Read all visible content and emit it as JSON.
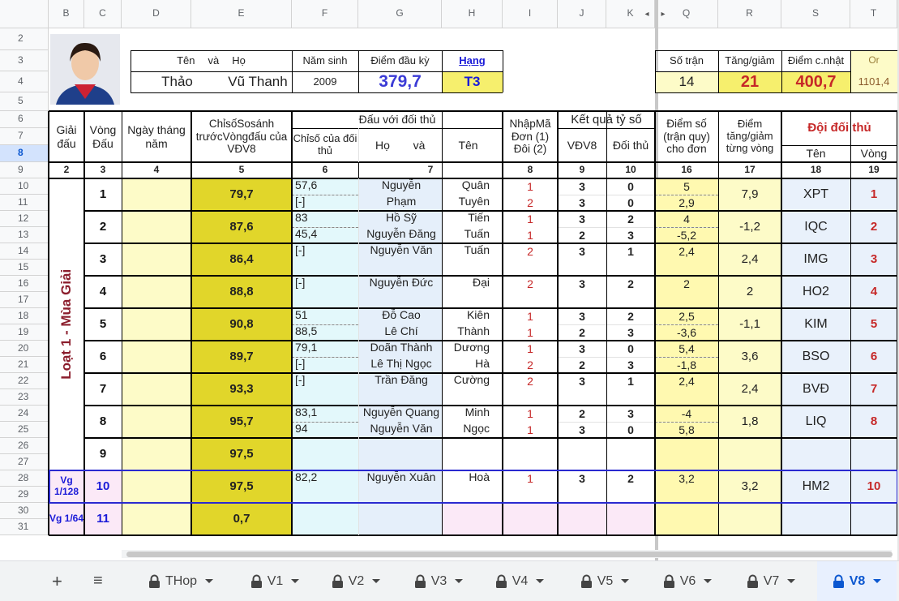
{
  "columns": [
    {
      "label": "B",
      "sel": false
    },
    {
      "label": "C",
      "sel": false
    },
    {
      "label": "D",
      "sel": false
    },
    {
      "label": "E",
      "sel": false
    },
    {
      "label": "F",
      "sel": false
    },
    {
      "label": "G",
      "sel": false
    },
    {
      "label": "H",
      "sel": false
    },
    {
      "label": "I",
      "sel": false
    },
    {
      "label": "J",
      "sel": false
    },
    {
      "label": "K",
      "sel": false
    },
    {
      "label": "Q",
      "sel": false
    },
    {
      "label": "R",
      "sel": false
    },
    {
      "label": "S",
      "sel": false
    },
    {
      "label": "T",
      "sel": false
    }
  ],
  "rows": [
    "2",
    "3",
    "4",
    "5",
    "6",
    "7",
    "8",
    "9",
    "10",
    "11",
    "12",
    "13",
    "14",
    "15",
    "16",
    "17",
    "18",
    "19",
    "20",
    "21",
    "22",
    "23",
    "24",
    "25",
    "26",
    "27",
    "28",
    "29",
    "30",
    "31"
  ],
  "selected_row": "8",
  "profile": {
    "name_header": [
      "Tên",
      "và",
      "Họ"
    ],
    "first_name": "Thảo",
    "last_name": "Vũ Thanh",
    "birth_year_label": "Năm sinh",
    "birth_year": "2009",
    "start_points_label": "Điểm đầu kỳ",
    "start_points": "379,7",
    "rank_label": "Hạng",
    "rank": "T3"
  },
  "summary": {
    "matches_label": "Số trận",
    "matches": "14",
    "change_label": "Tăng/giảm",
    "change": "21",
    "updated_label": "Điểm c.nhật",
    "updated": "400,7",
    "or_label": "Or",
    "or_value": "1101,4"
  },
  "headers": {
    "giai_dau": "Giải đấu",
    "vong_dau": "Vòng Đấu",
    "ngay": "Ngày tháng năm",
    "chiso": "ChỉsốSosánh trướcVòngđấu của VĐV8",
    "dau_voi": "Đấu với đối thủ",
    "chiso_dt": "Chỉsố của đối thủ",
    "ho": "Họ",
    "va": "và",
    "ten": "Tên",
    "nhap_ma": "NhậpMã Đơn (1) Đôi (2)",
    "ket_qua": "Kết quả tỷ số",
    "vdv8": "VĐV8",
    "doi_thu": "Đối thủ",
    "diem_so": "Điểm số (trận quy) cho đơn",
    "diem_tang": "Điểm tăng/giảm từng vòng",
    "doi_doi_thu": "Đội đối thủ",
    "doi_ten": "Tên",
    "doi_vong": "Vòng"
  },
  "col_numbers": [
    "2",
    "3",
    "4",
    "5",
    "6",
    "7",
    "8",
    "9",
    "10",
    "16",
    "17",
    "18",
    "19"
  ],
  "season_label": "Loạt 1 - Mùa Giải",
  "vg1_label": "Vg 1/128",
  "vg2_label": "Vg 1/64",
  "rounds": [
    {
      "vong": "1",
      "chiso": "79,7",
      "tang": "7,9",
      "team": "XPT",
      "team_round": "1",
      "lines": [
        {
          "cs": "57,6",
          "ho": "Nguyễn",
          "ten": "Quân",
          "ma": "1",
          "v": "3",
          "d": "0",
          "pts": "5"
        },
        {
          "cs": "[-]",
          "ho": "Phạm",
          "ten": "Tuyên",
          "ma": "2",
          "v": "3",
          "d": "0",
          "pts": "2,9"
        }
      ]
    },
    {
      "vong": "2",
      "chiso": "87,6",
      "tang": "-1,2",
      "team": "IQC",
      "team_round": "2",
      "lines": [
        {
          "cs": "83",
          "ho": "Hồ Sỹ",
          "ten": "Tiến",
          "ma": "1",
          "v": "3",
          "d": "2",
          "pts": "4"
        },
        {
          "cs": "45,4",
          "ho": "Nguyễn Đăng",
          "ten": "Tuấn",
          "ma": "1",
          "v": "2",
          "d": "3",
          "pts": "-5,2"
        }
      ]
    },
    {
      "vong": "3",
      "chiso": "86,4",
      "tang": "2,4",
      "team": "IMG",
      "team_round": "3",
      "lines": [
        {
          "cs": "[-]",
          "ho": "Nguyễn Văn",
          "ten": "Tuấn",
          "ma": "2",
          "v": "3",
          "d": "1",
          "pts": "2,4"
        }
      ]
    },
    {
      "vong": "4",
      "chiso": "88,8",
      "tang": "2",
      "team": "HO2",
      "team_round": "4",
      "lines": [
        {
          "cs": "[-]",
          "ho": "Nguyễn Đức",
          "ten": "Đại",
          "ma": "2",
          "v": "3",
          "d": "2",
          "pts": "2"
        }
      ]
    },
    {
      "vong": "5",
      "chiso": "90,8",
      "tang": "-1,1",
      "team": "KIM",
      "team_round": "5",
      "lines": [
        {
          "cs": "51",
          "ho": "Đỗ Cao",
          "ten": "Kiên",
          "ma": "1",
          "v": "3",
          "d": "2",
          "pts": "2,5"
        },
        {
          "cs": "88,5",
          "ho": "Lê Chí",
          "ten": "Thành",
          "ma": "1",
          "v": "2",
          "d": "3",
          "pts": "-3,6"
        }
      ]
    },
    {
      "vong": "6",
      "chiso": "89,7",
      "tang": "3,6",
      "team": "BSO",
      "team_round": "6",
      "lines": [
        {
          "cs": "79,1",
          "ho": "Doãn Thành",
          "ten": "Dương",
          "ma": "1",
          "v": "3",
          "d": "0",
          "pts": "5,4"
        },
        {
          "cs": "[-]",
          "ho": "Lê Thị Ngọc",
          "ten": "Hà",
          "ma": "2",
          "v": "2",
          "d": "3",
          "pts": "-1,8"
        }
      ]
    },
    {
      "vong": "7",
      "chiso": "93,3",
      "tang": "2,4",
      "team": "BVĐ",
      "team_round": "7",
      "lines": [
        {
          "cs": "[-]",
          "ho": "Trần Đăng",
          "ten": "Cường",
          "ma": "2",
          "v": "3",
          "d": "1",
          "pts": "2,4"
        }
      ]
    },
    {
      "vong": "8",
      "chiso": "95,7",
      "tang": "1,8",
      "team": "LIQ",
      "team_round": "8",
      "lines": [
        {
          "cs": "83,1",
          "ho": "Nguyễn Quang",
          "ten": "Minh",
          "ma": "1",
          "v": "2",
          "d": "3",
          "pts": "-4"
        },
        {
          "cs": "94",
          "ho": "Nguyễn Văn",
          "ten": "Ngọc",
          "ma": "1",
          "v": "3",
          "d": "0",
          "pts": "5,8"
        }
      ]
    },
    {
      "vong": "9",
      "chiso": "97,5",
      "tang": "",
      "team": "",
      "team_round": "",
      "lines": []
    },
    {
      "vong": "10",
      "chiso": "97,5",
      "tang": "3,2",
      "team": "HM2",
      "team_round": "10",
      "lines": [
        {
          "cs": "82,2",
          "ho": "Nguyễn Xuân",
          "ten": "Hoà",
          "ma": "1",
          "v": "3",
          "d": "2",
          "pts": "3,2"
        }
      ]
    },
    {
      "vong": "11",
      "chiso": "0,7",
      "tang": "",
      "team": "",
      "team_round": "",
      "lines": []
    }
  ],
  "sheet_tabs": [
    {
      "label": "THop",
      "active": false
    },
    {
      "label": "V1",
      "active": false
    },
    {
      "label": "V2",
      "active": false
    },
    {
      "label": "V3",
      "active": false
    },
    {
      "label": "V4",
      "active": false
    },
    {
      "label": "V5",
      "active": false
    },
    {
      "label": "V6",
      "active": false
    },
    {
      "label": "V7",
      "active": false
    },
    {
      "label": "V8",
      "active": true
    }
  ],
  "colors": {
    "yellow": "#f6ef6d",
    "pale_yellow": "#fdfbc8",
    "olive": "#e1d62a",
    "cyan": "#e3f8fb",
    "blue_col": "#e5effa",
    "pink": "#fbe9f7",
    "light_blue": "#e9f1fb",
    "grey": "#eeeeee"
  }
}
